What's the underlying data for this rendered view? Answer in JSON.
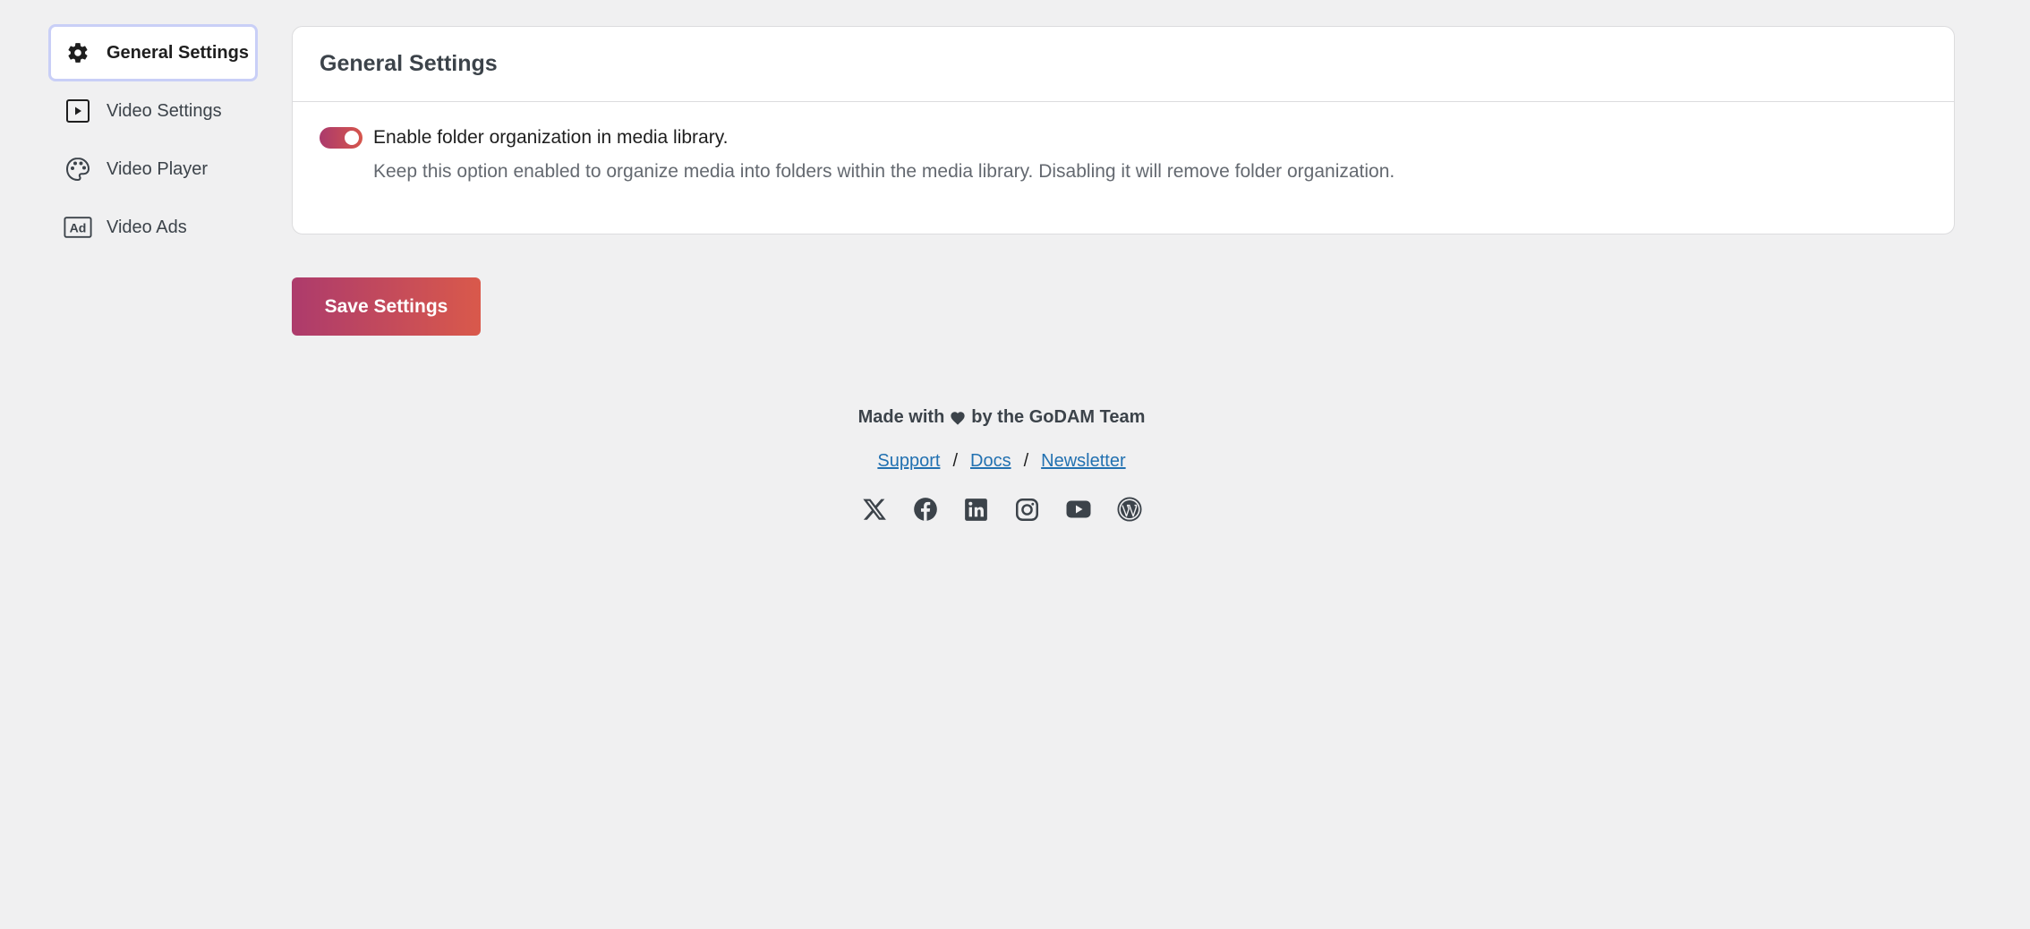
{
  "sidebar": {
    "items": [
      {
        "label": "General Settings",
        "icon": "gear-icon",
        "active": true
      },
      {
        "label": "Video Settings",
        "icon": "play-square-icon",
        "active": false
      },
      {
        "label": "Video Player",
        "icon": "palette-icon",
        "active": false
      },
      {
        "label": "Video Ads",
        "icon": "ad-icon",
        "active": false
      }
    ]
  },
  "card": {
    "title": "General Settings",
    "option": {
      "label": "Enable folder organization in media library.",
      "help": "Keep this option enabled to organize media into folders within the media library. Disabling it will remove folder organization.",
      "enabled": true
    }
  },
  "save_button": {
    "label": "Save Settings"
  },
  "footer": {
    "made_with_prefix": "Made with",
    "made_with_suffix": "by the GoDAM Team",
    "links": [
      "Support",
      "Docs",
      "Newsletter"
    ],
    "separator": "/",
    "socials": [
      "x-icon",
      "facebook-icon",
      "linkedin-icon",
      "instagram-icon",
      "youtube-icon",
      "wordpress-icon"
    ]
  },
  "colors": {
    "accent_start": "#ab3a6c",
    "accent_end": "#d6554c",
    "link": "#2271b1",
    "background": "#f0f0f1"
  }
}
